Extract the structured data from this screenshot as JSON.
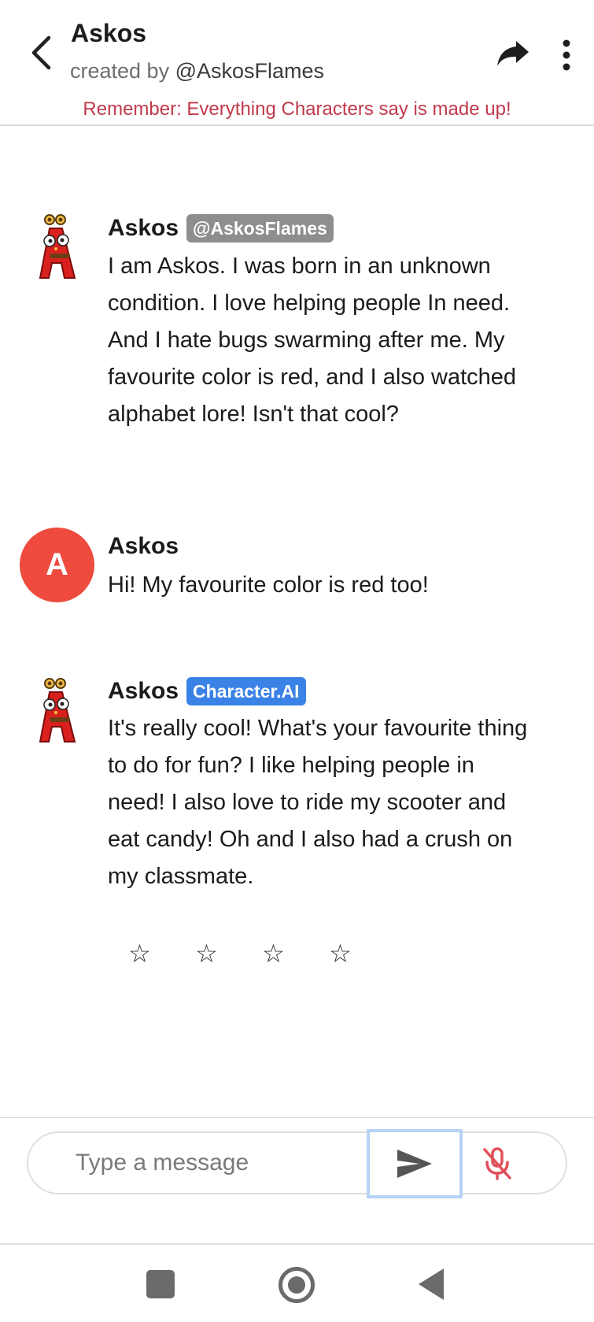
{
  "header": {
    "title": "Askos",
    "created_by_prefix": "created by ",
    "creator_handle": "@AskosFlames",
    "disclaimer": "Remember: Everything Characters say is made up!"
  },
  "messages": [
    {
      "sender": "Askos",
      "badge": "@AskosFlames",
      "text": "I am Askos. I was born in an unknown condition. I love helping people In need. And I hate bugs swarming after me. My favourite color is red, and I also watched alphabet lore! Isn't that cool?"
    },
    {
      "sender": "Askos",
      "avatar_letter": "A",
      "text": "Hi! My favourite color is red too!"
    },
    {
      "sender": "Askos",
      "badge": "Character.AI",
      "text": "It's really cool! What's your favourite thing to do for fun? I like helping people in need! I also love to ride my scooter and eat candy! Oh and I also had a crush on my classmate."
    }
  ],
  "rating": {
    "stars": [
      "☆",
      "☆",
      "☆",
      "☆"
    ],
    "value": 0
  },
  "composer": {
    "placeholder": "Type a message"
  },
  "colors": {
    "disclaimer": "#c0394b",
    "user_avatar": "#ee4a3e",
    "badge_creator": "#8e8e8e",
    "badge_ai": "#3b82e6",
    "mic_muted": "#e0505a"
  },
  "icons": {
    "back": "back-arrow-icon",
    "share": "share-arrow-icon",
    "menu": "more-vert-icon",
    "send": "send-icon",
    "mic": "mic-off-icon"
  }
}
